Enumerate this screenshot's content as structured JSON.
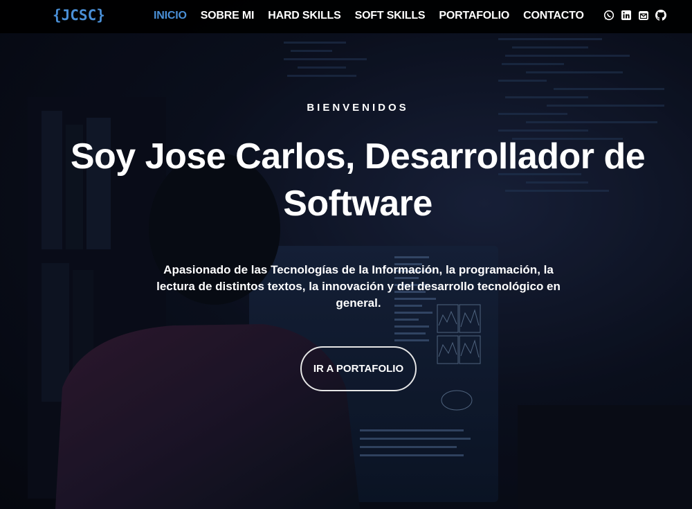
{
  "nav": {
    "brand": "{JCSC}",
    "links": [
      {
        "label": "INICIO",
        "active": true
      },
      {
        "label": "SOBRE MI",
        "active": false
      },
      {
        "label": "HARD SKILLS",
        "active": false
      },
      {
        "label": "SOFT SKILLS",
        "active": false
      },
      {
        "label": "PORTAFOLIO",
        "active": false
      },
      {
        "label": "CONTACTO",
        "active": false
      }
    ],
    "social_icons": [
      "whatsapp-icon",
      "linkedin-icon",
      "email-icon",
      "github-icon"
    ]
  },
  "hero": {
    "welcome": "BIENVENIDOS",
    "title": "Soy Jose Carlos, Desarrollador de Software",
    "description": "Apasionado de las Tecnologías de la Información, la programación, la lectura de distintos textos, la innovación y del desarrollo tecnológico en general.",
    "cta_label": "IR A PORTAFOLIO"
  },
  "colors": {
    "accent": "#4a8fd6",
    "navbar_bg": "#000000",
    "text": "#ffffff"
  }
}
